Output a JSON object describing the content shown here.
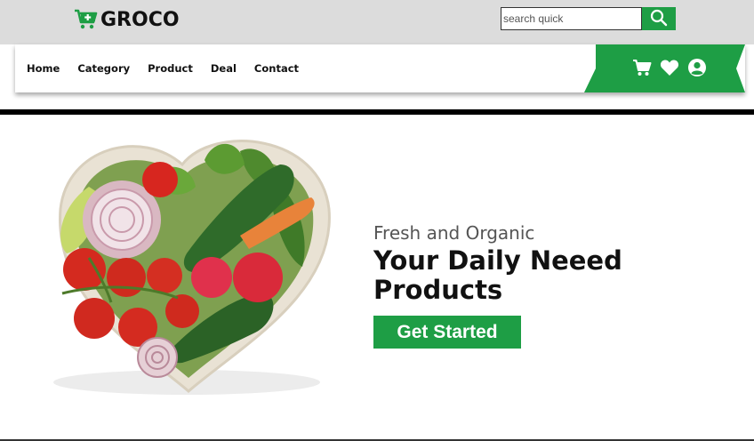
{
  "brand": {
    "name": "GROCO",
    "accent": "#1e9e45"
  },
  "search": {
    "placeholder": "search quick",
    "value": "",
    "icon": "search-icon"
  },
  "nav": {
    "links": [
      {
        "label": "Home"
      },
      {
        "label": "Category"
      },
      {
        "label": "Product"
      },
      {
        "label": "Deal"
      },
      {
        "label": "Contact"
      }
    ],
    "icons": [
      "cart-icon",
      "heart-icon",
      "user-icon"
    ]
  },
  "hero": {
    "subtitle": "Fresh and Organic",
    "title": "Your Daily Neeed Products",
    "cta_label": "Get Started",
    "image": "heart-shaped-vegetable-bowl"
  }
}
